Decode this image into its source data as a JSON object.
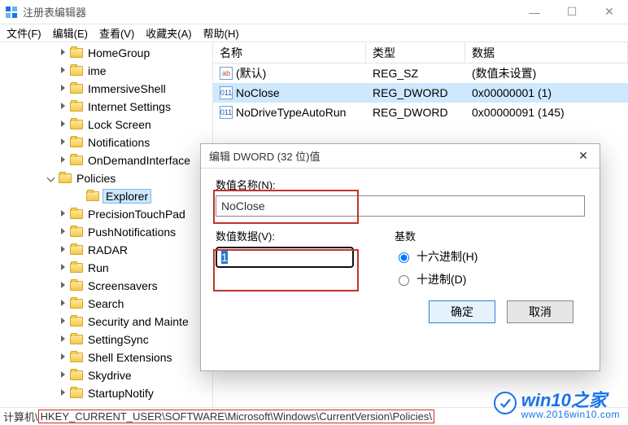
{
  "window": {
    "title": "注册表编辑器"
  },
  "menu": {
    "file": "文件(F)",
    "edit": "编辑(E)",
    "view": "查看(V)",
    "favorites": "收藏夹(A)",
    "help": "帮助(H)"
  },
  "tree": {
    "items": [
      {
        "label": "HomeGroup",
        "indent": 72,
        "twisty": "closed"
      },
      {
        "label": "ime",
        "indent": 72,
        "twisty": "closed"
      },
      {
        "label": "ImmersiveShell",
        "indent": 72,
        "twisty": "closed"
      },
      {
        "label": "Internet Settings",
        "indent": 72,
        "twisty": "closed"
      },
      {
        "label": "Lock Screen",
        "indent": 72,
        "twisty": "closed"
      },
      {
        "label": "Notifications",
        "indent": 72,
        "twisty": "closed"
      },
      {
        "label": "OnDemandInterface",
        "indent": 72,
        "twisty": "closed"
      },
      {
        "label": "Policies",
        "indent": 58,
        "twisty": "open"
      },
      {
        "label": "Explorer",
        "indent": 92,
        "twisty": "none",
        "selected": true
      },
      {
        "label": "PrecisionTouchPad",
        "indent": 72,
        "twisty": "closed"
      },
      {
        "label": "PushNotifications",
        "indent": 72,
        "twisty": "closed"
      },
      {
        "label": "RADAR",
        "indent": 72,
        "twisty": "closed"
      },
      {
        "label": "Run",
        "indent": 72,
        "twisty": "closed"
      },
      {
        "label": "Screensavers",
        "indent": 72,
        "twisty": "closed"
      },
      {
        "label": "Search",
        "indent": 72,
        "twisty": "closed"
      },
      {
        "label": "Security and Mainte",
        "indent": 72,
        "twisty": "closed"
      },
      {
        "label": "SettingSync",
        "indent": 72,
        "twisty": "closed"
      },
      {
        "label": "Shell Extensions",
        "indent": 72,
        "twisty": "closed"
      },
      {
        "label": "Skydrive",
        "indent": 72,
        "twisty": "closed"
      },
      {
        "label": "StartupNotify",
        "indent": 72,
        "twisty": "closed"
      }
    ]
  },
  "list": {
    "header": {
      "name": "名称",
      "type": "类型",
      "data": "数据"
    },
    "rows": [
      {
        "name": "(默认)",
        "type": "REG_SZ",
        "data": "(数值未设置)",
        "icon": "str"
      },
      {
        "name": "NoClose",
        "type": "REG_DWORD",
        "data": "0x00000001 (1)",
        "icon": "bin",
        "selected": true
      },
      {
        "name": "NoDriveTypeAutoRun",
        "type": "REG_DWORD",
        "data": "0x00000091 (145)",
        "icon": "bin"
      }
    ]
  },
  "dialog": {
    "title": "编辑 DWORD (32 位)值",
    "name_label": "数值名称(N):",
    "name_value": "NoClose",
    "data_label": "数值数据(V):",
    "data_value": "1",
    "base_label": "基数",
    "radio_hex": "十六进制(H)",
    "radio_dec": "十进制(D)",
    "ok": "确定",
    "cancel": "取消"
  },
  "statusbar": {
    "prefix": "计算机\\",
    "path": "HKEY_CURRENT_USER\\SOFTWARE\\Microsoft\\Windows\\CurrentVersion\\Policies\\"
  },
  "watermark": {
    "text": "win10之家",
    "domain": "www.2016win10.com"
  }
}
